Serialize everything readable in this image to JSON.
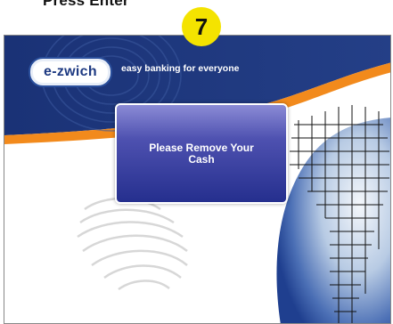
{
  "instruction_caption": "Press Enter",
  "step_number": "7",
  "atm_screen": {
    "logo_text": "e-zwich",
    "tagline": "easy banking for everyone",
    "message": "Please Remove Your Cash"
  },
  "colors": {
    "header_blue": "#223a80",
    "accent_orange": "#f28a1c",
    "step_badge_yellow": "#f4e300",
    "message_box_purple": "#3a3f9e"
  }
}
